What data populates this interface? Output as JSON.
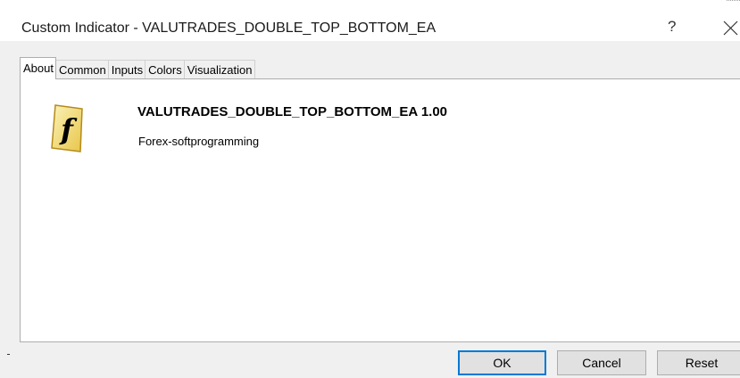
{
  "window": {
    "title": "Custom Indicator - VALUTRADES_DOUBLE_TOP_BOTTOM_EA",
    "help_label": "?"
  },
  "tabs": [
    {
      "label": "About",
      "active": true
    },
    {
      "label": "Common",
      "active": false
    },
    {
      "label": "Inputs",
      "active": false
    },
    {
      "label": "Colors",
      "active": false
    },
    {
      "label": "Visualization",
      "active": false
    }
  ],
  "about": {
    "icon": "function-icon",
    "icon_glyph": "f",
    "name": "VALUTRADES_DOUBLE_TOP_BOTTOM_EA 1.00",
    "author": "Forex-softprogramming"
  },
  "buttons": {
    "ok": "OK",
    "cancel": "Cancel",
    "reset": "Reset"
  },
  "colors": {
    "accent": "#0078d7",
    "icon_fill": "#f6e27a",
    "icon_edge": "#b48a1c"
  }
}
